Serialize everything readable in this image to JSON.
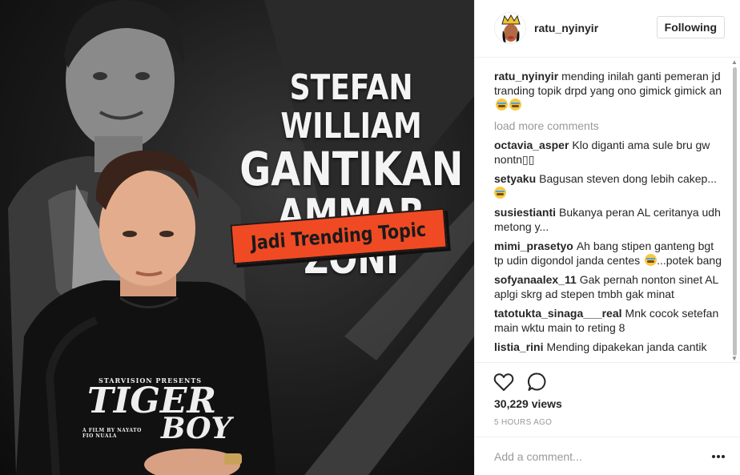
{
  "media": {
    "headline_line1": "STEFAN WILLIAM",
    "headline_line2": "GANTIKAN",
    "headline_line3": "AMMAR ZONI",
    "banner": "Jadi Trending Topic",
    "shirt_small": "STARVISION PRESENTS",
    "shirt_title_1": "TIGER",
    "shirt_title_2": "BOY",
    "shirt_credit": "A FILM BY NAYATO FIO NUALA"
  },
  "header": {
    "username": "ratu_nyinyir",
    "follow_label": "Following"
  },
  "caption": {
    "username": "ratu_nyinyir",
    "text": "mending inilah ganti pemeran jd tranding topik drpd yang ono gimick gimick an"
  },
  "load_more": "load more comments",
  "comments": [
    {
      "username": "octavia_asper",
      "text": "Klo diganti ama sule bru gw nontn▯▯"
    },
    {
      "username": "setyaku",
      "text": "Bagusan steven dong lebih cakep..."
    },
    {
      "username": "susiestianti",
      "text": "Bukanya peran AL ceritanya udh metong y..."
    },
    {
      "username": "mimi_prasetyo",
      "text": "Ah bang stipen ganteng bgt tp udin digondol janda centes",
      "text_after": "...potek bang"
    },
    {
      "username": "sofyanaalex_11",
      "text": "Gak pernah nonton sinet AL aplgi skrg ad stepen tmbh gak minat"
    },
    {
      "username": "tatotukta_sinaga___real",
      "text": "Mnk cocok setefan main wktu main to reting 8"
    },
    {
      "username": "listia_rini",
      "text": "Mending dipakekan janda cantik"
    }
  ],
  "stats": {
    "views": "30,229 views",
    "time": "5 HOURS AGO"
  },
  "add_comment": {
    "placeholder": "Add a comment..."
  },
  "icons": {
    "like": "heart-icon",
    "comment": "speech-bubble-icon",
    "more": "more-options-icon"
  },
  "colors": {
    "banner": "#f04a24",
    "muted_text": "#999999",
    "border": "#efefef"
  }
}
